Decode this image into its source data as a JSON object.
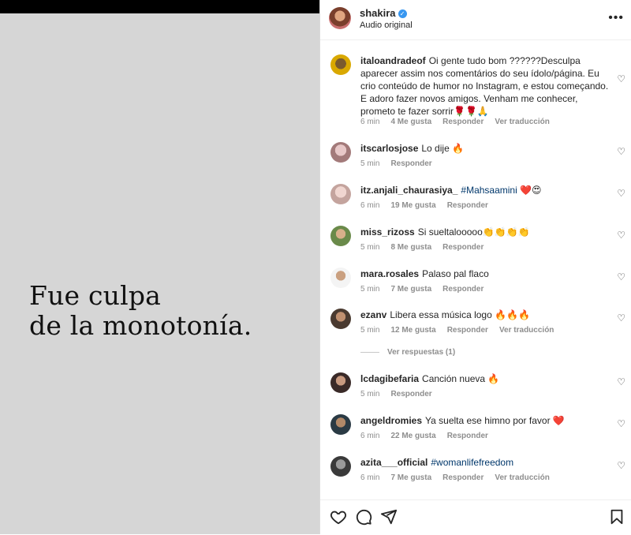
{
  "media": {
    "caption_lines": [
      "Fue culpa",
      "de la monotonía."
    ]
  },
  "header": {
    "username": "shakira",
    "subtitle": "Audio original",
    "more_icon": "more-options-icon"
  },
  "comments": [
    {
      "user": "italoandradeof",
      "text": "Oi gente tudo bom ??????Desculpa aparecer assim nos comentários do seu ídolo/página. Eu crio conteúdo de humor no Instagram, e estou começando. E adoro fazer novos amigos. Venham me conhecer, prometo te fazer sorrir🌹🌹🙏",
      "time": "6 min",
      "likes": "4 Me gusta",
      "reply": "Responder",
      "translate": "Ver traducción"
    },
    {
      "user": "itscarlosjose",
      "text": "Lo dije 🔥",
      "time": "5 min",
      "likes": "",
      "reply": "Responder",
      "translate": ""
    },
    {
      "user": "itz.anjali_chaurasiya_",
      "tag": "#Mahsaamini",
      "text": " ❤️😍",
      "time": "6 min",
      "likes": "19 Me gusta",
      "reply": "Responder",
      "translate": ""
    },
    {
      "user": "miss_rizoss",
      "text": "Si sueltalooooo👏👏👏👏",
      "time": "5 min",
      "likes": "8 Me gusta",
      "reply": "Responder",
      "translate": ""
    },
    {
      "user": "mara.rosales",
      "text": "Palaso pal flaco",
      "time": "5 min",
      "likes": "7 Me gusta",
      "reply": "Responder",
      "translate": ""
    },
    {
      "user": "ezanv",
      "text": "Libera essa música logo 🔥🔥🔥",
      "time": "5 min",
      "likes": "12 Me gusta",
      "reply": "Responder",
      "translate": "Ver traducción",
      "view_replies": "Ver respuestas (1)"
    },
    {
      "user": "lcdagibefaria",
      "text": "Canción nueva 🔥",
      "time": "5 min",
      "likes": "",
      "reply": "Responder",
      "translate": ""
    },
    {
      "user": "angeldromies",
      "text": "Ya suelta ese himno por favor ❤️",
      "time": "6 min",
      "likes": "22 Me gusta",
      "reply": "Responder",
      "translate": ""
    },
    {
      "user": "azita___official",
      "tag": "#womanlifefreedom",
      "text": "",
      "time": "6 min",
      "likes": "7 Me gusta",
      "reply": "Responder",
      "translate": "Ver traducción"
    }
  ],
  "icons": {
    "like": "heart-icon",
    "comment": "comment-icon",
    "share": "share-icon",
    "save": "bookmark-icon"
  }
}
